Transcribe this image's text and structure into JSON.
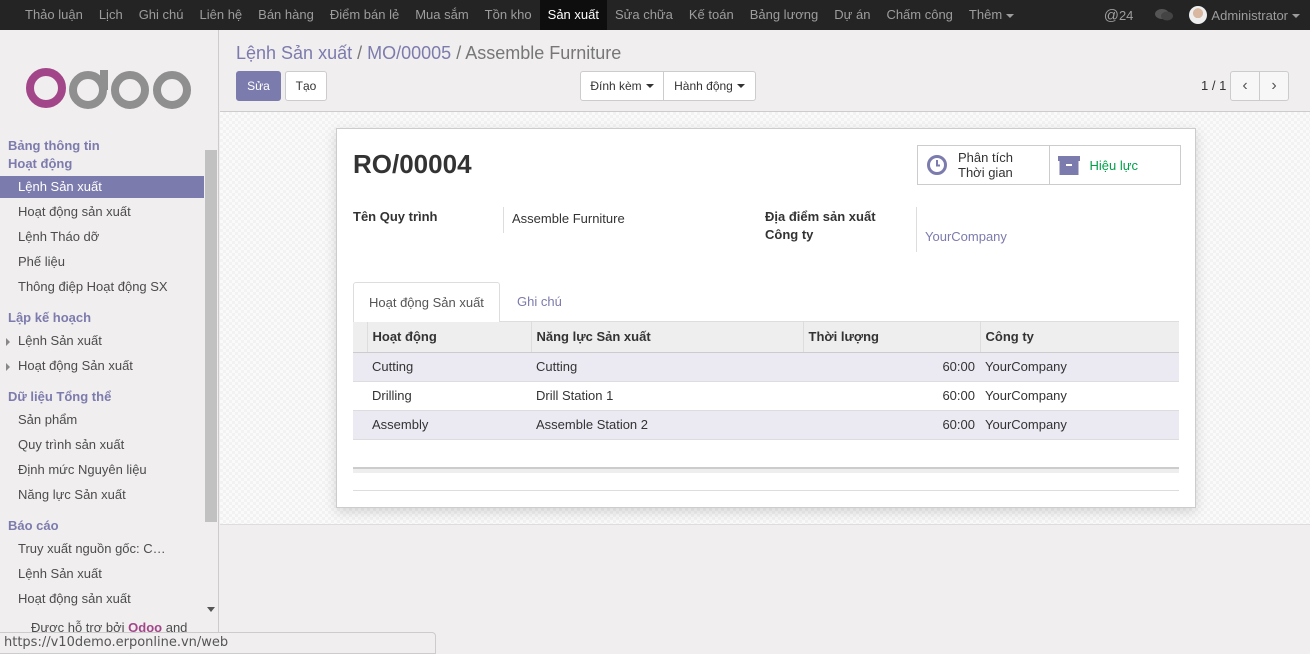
{
  "topnav": {
    "menus": [
      "Thảo luận",
      "Lịch",
      "Ghi chú",
      "Liên hệ",
      "Bán hàng",
      "Điểm bán lẻ",
      "Mua sắm",
      "Tồn kho",
      "Sản xuất",
      "Sửa chữa",
      "Kế toán",
      "Bảng lương",
      "Dự án",
      "Chấm công",
      "Thêm"
    ],
    "active": "Sản xuất",
    "mentions": "24",
    "user": "Administrator"
  },
  "sidebar": {
    "sections": [
      {
        "title": "Bảng thông tin"
      },
      {
        "title": "Hoạt động"
      },
      {
        "title": "Lập kế hoạch"
      },
      {
        "title": "Dữ liệu Tổng thể"
      },
      {
        "title": "Báo cáo"
      }
    ],
    "items": [
      "Lệnh Sản xuất",
      "Hoạt động sản xuất",
      "Lệnh Tháo dỡ",
      "Phế liệu",
      "Thông điệp Hoạt động SX",
      "Lệnh Sản xuất",
      "Hoạt động Sản xuất",
      "Sản phẩm",
      "Quy trình sản xuất",
      "Định mức Nguyên liệu",
      "Năng lực Sản xuất",
      "Truy xuất nguồn gốc: C…",
      "Lệnh Sản xuất",
      "Hoạt động sản xuất"
    ],
    "powered_prefix": "Được hỗ trợ bởi",
    "powered_brand": "Odoo",
    "powered_suffix": "and",
    "logo": "odoo"
  },
  "statusbar": "https://v10demo.erponline.vn/web",
  "breadcrumb": [
    "Lệnh Sản xuất",
    "MO/00005",
    "Assemble Furniture"
  ],
  "buttons": {
    "edit": "Sửa",
    "create": "Tạo",
    "attach": "Đính kèm",
    "action": "Hành động"
  },
  "pager": "1 / 1",
  "form": {
    "title": "RO/00004",
    "smart_buttons": {
      "time": [
        "Phân tích",
        "Thời gian"
      ],
      "active": "Hiệu lực"
    },
    "fields": {
      "routing_label": "Tên Quy trình",
      "routing": "Assemble Furniture",
      "location_label": "Địa điểm sản xuất",
      "location": "",
      "company_label": "Công ty",
      "company": "YourCompany"
    },
    "tabs": [
      "Hoạt động Sản xuất",
      "Ghi chú"
    ],
    "table": {
      "headers": [
        "Hoạt động",
        "Năng lực Sản xuất",
        "Thời lượng",
        "Công ty"
      ],
      "rows": [
        [
          "Cutting",
          "Cutting",
          "60:00",
          "YourCompany"
        ],
        [
          "Drilling",
          "Drill Station 1",
          "60:00",
          "YourCompany"
        ],
        [
          "Assembly",
          "Assemble Station 2",
          "60:00",
          "YourCompany"
        ]
      ]
    }
  },
  "colors": {
    "accent": "#7c7bad",
    "nav": "#242424",
    "active_green": "#00a04a"
  }
}
